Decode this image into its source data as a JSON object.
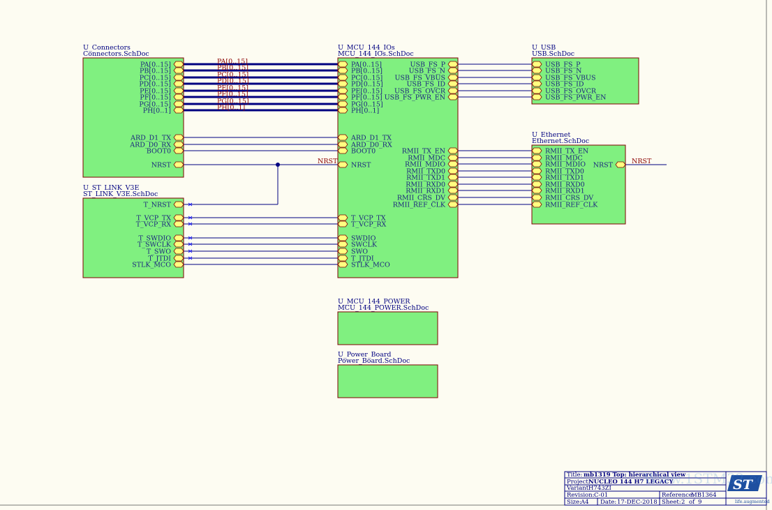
{
  "blocks": [
    {
      "id": "conn",
      "designator": "U_Connectors",
      "file": "Connectors.SchDoc"
    },
    {
      "id": "stlink",
      "designator": "U_ST_LINK_V3E",
      "file": "ST_LINK_V3E.SchDoc"
    },
    {
      "id": "mcu",
      "designator": "U_MCU_144_IOs",
      "file": "MCU_144_IOs.SchDoc"
    },
    {
      "id": "usb",
      "designator": "U_USB",
      "file": "USB.SchDoc"
    },
    {
      "id": "eth",
      "designator": "U_Ethernet",
      "file": "Ethernet.SchDoc"
    },
    {
      "id": "power",
      "designator": "U_MCU_144_POWER",
      "file": "MCU_144_POWER.SchDoc"
    },
    {
      "id": "pboard",
      "designator": "U_Power_Board",
      "file": "Power_Board.SchDoc"
    }
  ],
  "ports": {
    "conn_right": [
      "PA[0..15]",
      "PB[0..15]",
      "PC[0..15]",
      "PD[0..15]",
      "PE[0..15]",
      "PF[0..15]",
      "PG[0..15]",
      "PH[0..1]",
      "ARD_D1_TX",
      "ARD_D0_RX",
      "BOOT0",
      "NRST"
    ],
    "mcu_left": [
      "PA[0..15]",
      "PB[0..15]",
      "PC[0..15]",
      "PD[0..15]",
      "PE[0..15]",
      "PF[0..15]",
      "PG[0..15]",
      "PH[0..1]",
      "ARD_D1_TX",
      "ARD_D0_RX",
      "BOOT0",
      "NRST",
      "T_VCP_TX",
      "T_VCP_RX",
      "SWDIO",
      "SWCLK",
      "SWO",
      "T_JTDI",
      "STLK_MCO"
    ],
    "mcu_right": [
      "USB_FS_P",
      "USB_FS_N",
      "USB_FS_VBUS",
      "USB_FS_ID",
      "USB_FS_OVCR",
      "USB_FS_PWR_EN",
      "RMII_TX_EN",
      "RMII_MDC",
      "RMII_MDIO",
      "RMII_TXD0",
      "RMII_TXD1",
      "RMII_RXD0",
      "RMII_RXD1",
      "RMII_CRS_DV",
      "RMII_REF_CLK"
    ],
    "usb_left": [
      "USB_FS_P",
      "USB_FS_N",
      "USB_FS_VBUS",
      "USB_FS_ID",
      "USB_FS_OVCR",
      "USB_FS_PWR_EN"
    ],
    "eth_left": [
      "RMII_TX_EN",
      "RMII_MDC",
      "RMII_MDIO",
      "RMII_TXD0",
      "RMII_TXD1",
      "RMII_RXD0",
      "RMII_RXD1",
      "RMII_CRS_DV",
      "RMII_REF_CLK"
    ],
    "eth_right": [
      "NRST"
    ],
    "stlink_right": [
      "T_NRST",
      "T_VCP_TX",
      "T_VCP_RX",
      "T_SWDIO",
      "T_SWCLK",
      "T_SWO",
      "T_JTDI",
      "STLK_MCO"
    ]
  },
  "bus_nets": [
    "PA[0..15]",
    "PB[0..15]",
    "PC[0..15]",
    "PD[0..15]",
    "PE[0..15]",
    "PF[0..15]",
    "PG[0..15]",
    "PH[0..1]"
  ],
  "net_labels": {
    "nrst_mcu": "NRST",
    "nrst_eth": "NRST"
  },
  "titleblock": {
    "title_label": "Title:",
    "title": "mb1319 Top: hierarchical view",
    "project_label": "Project:",
    "project": "NUCLEO 144 H7 LEGACY",
    "variant_label": "Variant:",
    "variant": "H743ZI",
    "revision_label": "Revision:",
    "revision": "C-01",
    "reference_label": "Reference:",
    "reference": "MB1364",
    "size_label": "Size:",
    "size": "A4",
    "date_label": "Date:",
    "date": "17-DEC-2018",
    "sheet_label": "Sheet:",
    "sheet_num": "2",
    "sheet_of": "of",
    "sheet_total": "9",
    "logo_text": "life.augmented",
    "watermark": "Www.1STM32.com"
  },
  "colors": {
    "block_fill": "#80f080",
    "block_stroke": "#800000",
    "wire": "#000080",
    "port_fill": "#ffff80",
    "background": "#fdfcf2"
  }
}
